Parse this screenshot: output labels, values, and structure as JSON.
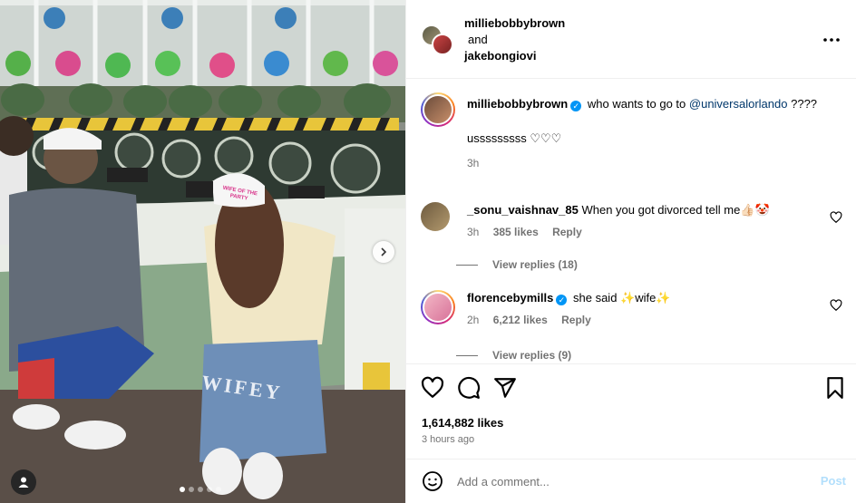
{
  "photo": {
    "hat_text": "WIFE OF THE PARTY",
    "shorts_text": "WIFEY",
    "carousel_dots": 5,
    "active_dot": 0,
    "next_icon": "chevron-right-icon",
    "tag_icon": "user-tag-icon"
  },
  "header": {
    "user1": "milliebobbybrown",
    "and": "and",
    "user2": "jakebongiovi",
    "more_icon": "more-horizontal-icon"
  },
  "caption": {
    "username": "milliebobbybrown",
    "text": "who wants to go to",
    "mention": "@universalorlando",
    "line1_tail": "????",
    "line2": "usssssssss ♡♡♡",
    "time": "3h"
  },
  "comments": [
    {
      "username": "_sonu_vaishnav_85",
      "verified": false,
      "text": "When you got divorced tell me👍🏻🤡",
      "time": "3h",
      "likes": "385 likes",
      "reply": "Reply",
      "view_replies": "View replies (18)"
    },
    {
      "username": "florencebymills",
      "verified": true,
      "text": "she said ✨wife✨",
      "time": "2h",
      "likes": "6,212 likes",
      "reply": "Reply",
      "view_replies": "View replies (9)"
    }
  ],
  "actions": {
    "like_icon": "heart-icon",
    "comment_icon": "comment-icon",
    "share_icon": "send-icon",
    "save_icon": "bookmark-icon",
    "likes": "1,614,882 likes",
    "time": "3 hours ago"
  },
  "add_comment": {
    "placeholder": "Add a comment...",
    "post_label": "Post",
    "emoji_icon": "emoji-icon"
  },
  "colors": {
    "verified": "#0095f6",
    "link": "#00376b",
    "muted": "#737373",
    "post_disabled": "#b2dffc"
  }
}
